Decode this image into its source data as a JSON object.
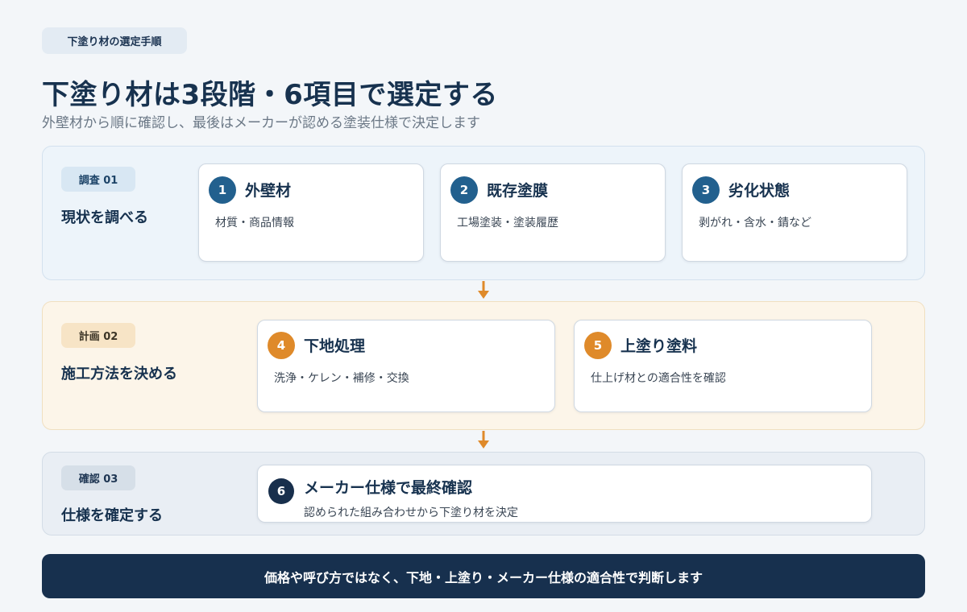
{
  "header": {
    "tag": "下塗り材の選定手順",
    "title": "下塗り材は3段階・6項目で選定する",
    "subtitle": "外壁材から順に確認し、最後はメーカーが認める塗装仕様で決定します"
  },
  "stages": [
    {
      "badge": "調査 01",
      "label": "現状を調べる",
      "items": [
        {
          "num": "1",
          "title": "外壁材",
          "desc": "材質・商品情報"
        },
        {
          "num": "2",
          "title": "既存塗膜",
          "desc": "工場塗装・塗装履歴"
        },
        {
          "num": "3",
          "title": "劣化状態",
          "desc": "剥がれ・含水・錆など"
        }
      ]
    },
    {
      "badge": "計画 02",
      "label": "施工方法を決める",
      "items": [
        {
          "num": "4",
          "title": "下地処理",
          "desc": "洗浄・ケレン・補修・交換"
        },
        {
          "num": "5",
          "title": "上塗り塗料",
          "desc": "仕上げ材との適合性を確認"
        }
      ]
    },
    {
      "badge": "確認 03",
      "label": "仕様を確定する",
      "items": [
        {
          "num": "6",
          "title": "メーカー仕様で最終確認",
          "desc": "認められた組み合わせから下塗り材を決定"
        }
      ]
    }
  ],
  "footer": "価格や呼び方ではなく、下地・上塗り・メーカー仕様の適合性で判断します",
  "colors": {
    "navy": "#17304e",
    "stage1_accent": "#22608e",
    "stage2_accent": "#df8a2a",
    "stage3_accent": "#182f4c",
    "arrow": "#df8a2a"
  }
}
